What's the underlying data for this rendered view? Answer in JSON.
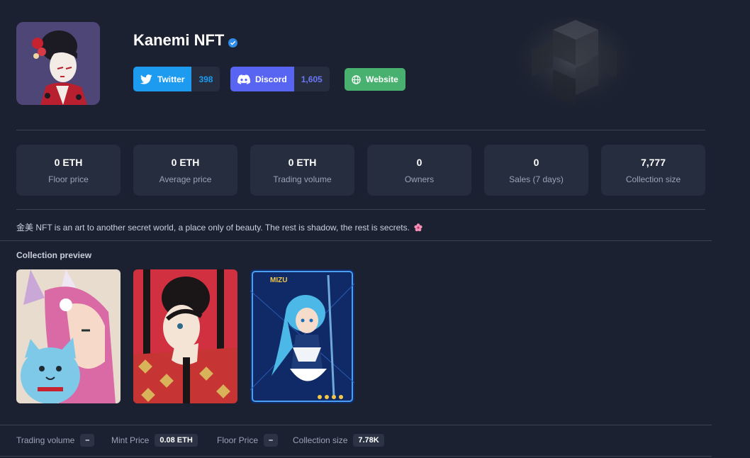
{
  "header": {
    "title": "Kanemi NFT",
    "avatar_icon": "geisha-avatar-icon",
    "verified_icon": "verified-check-icon"
  },
  "social": {
    "twitter": {
      "label": "Twitter",
      "count": "398",
      "icon": "twitter-bird-icon",
      "color": "#1d9bf0"
    },
    "discord": {
      "label": "Discord",
      "count": "1,605",
      "icon": "discord-icon",
      "color": "#5865f2"
    },
    "website": {
      "label": "Website",
      "icon": "globe-icon",
      "color": "#48b16f"
    }
  },
  "stats": [
    {
      "value": "0 ETH",
      "label": "Floor price"
    },
    {
      "value": "0 ETH",
      "label": "Average price"
    },
    {
      "value": "0 ETH",
      "label": "Trading volume"
    },
    {
      "value": "0",
      "label": "Owners"
    },
    {
      "value": "0",
      "label": "Sales (7 days)"
    },
    {
      "value": "7,777",
      "label": "Collection size"
    }
  ],
  "description": "金美 NFT is an art to another secret world, a place only of beauty. The rest is shadow, the rest is secrets.",
  "description_icon": "cherry-blossom-icon",
  "preview": {
    "title": "Collection preview",
    "items": [
      {
        "icon": "pink-hair-girl-with-cat-icon"
      },
      {
        "icon": "geisha-red-curtain-icon"
      },
      {
        "icon": "blue-hair-warrior-card-icon",
        "card_label": "MIZU"
      }
    ]
  },
  "footer": {
    "trading_volume_label": "Trading volume",
    "trading_volume_value": "–",
    "mint_price_label": "Mint Price",
    "mint_price_value": "0.08 ETH",
    "floor_price_label": "Floor Price",
    "floor_price_value": "–",
    "collection_size_label": "Collection size",
    "collection_size_value": "7.78K"
  }
}
